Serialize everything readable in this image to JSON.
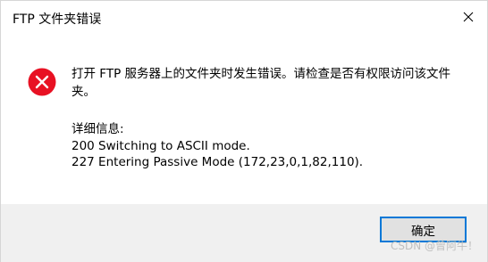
{
  "window": {
    "title": "FTP 文件夹错误",
    "close_icon": "close-icon"
  },
  "error_icon": "error-icon",
  "colors": {
    "error_red": "#e81123",
    "accent_blue": "#0078d7",
    "footer_bg": "#f0f0f0"
  },
  "message": "打开 FTP 服务器上的文件夹时发生错误。请检查是否有权限访问该文件夹。",
  "details": {
    "heading": "详细信息:",
    "lines": [
      "200 Switching to ASCII mode.",
      "227 Entering Passive Mode (172,23,0,1,82,110)."
    ]
  },
  "footer": {
    "ok_label": "确定",
    "watermark": "CSDN @曾阿牛！"
  }
}
